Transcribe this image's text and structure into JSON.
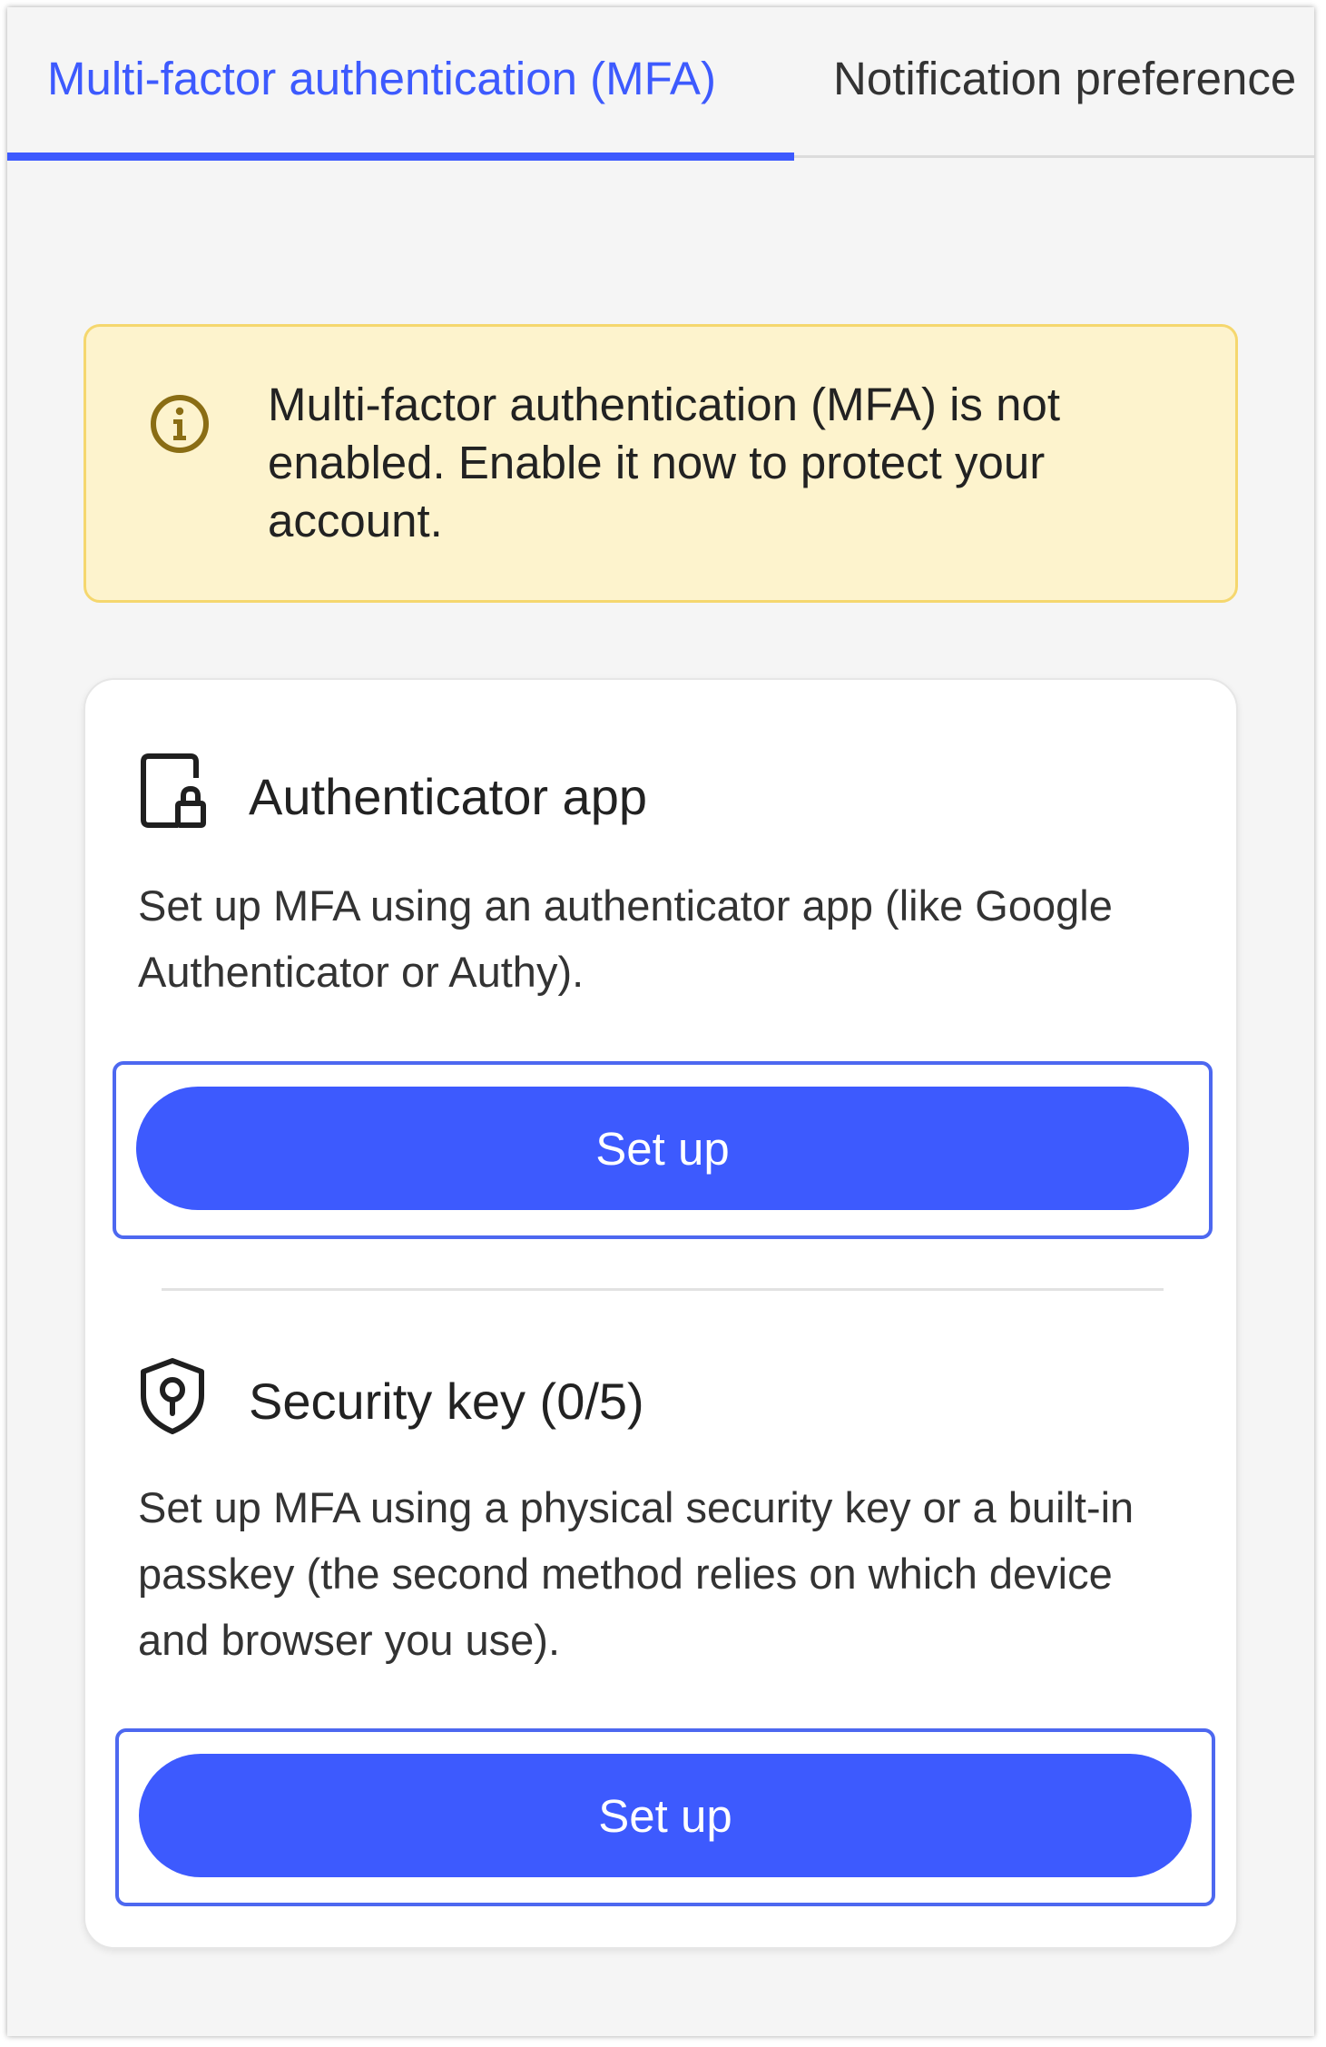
{
  "tabs": [
    {
      "label": "Multi-factor authentication (MFA)",
      "active": true
    },
    {
      "label": "Notification preference",
      "active": false
    }
  ],
  "warning": {
    "icon": "info-circle-icon",
    "text": "Multi-factor authentication (MFA) is not enabled. Enable it now to protect your account."
  },
  "methods": [
    {
      "icon": "tablet-lock-icon",
      "title": "Authenticator app",
      "description": "Set up MFA using an authenticator app (like Google Authenticator or Authy).",
      "button_label": "Set up"
    },
    {
      "icon": "shield-key-icon",
      "title": "Security key (0/5)",
      "description": "Set up MFA using a physical security key or a built-in passkey (the second method relies on which device and browser you use).",
      "button_label": "Set up"
    }
  ],
  "colors": {
    "accent": "#3d5afe",
    "warning_bg": "#fdf3cd",
    "warning_border": "#f5d76e",
    "warning_icon": "#8a6d14"
  }
}
